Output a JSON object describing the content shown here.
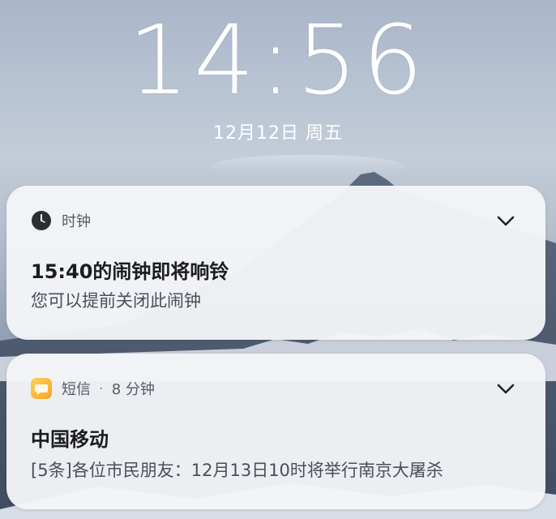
{
  "lockscreen": {
    "time": "14:56",
    "date": "12月12日 周五"
  },
  "notifications": [
    {
      "app_name": "时钟",
      "app_icon": "clock-icon",
      "title": "15:40的闹钟即将响铃",
      "body": "您可以提前关闭此闹钟"
    },
    {
      "app_name": "短信",
      "app_icon": "sms-icon",
      "separator": "·",
      "time_ago": "8 分钟",
      "title": "中国移动",
      "body": "[5条]各位市民朋友：12月13日10时将举行南京大屠杀"
    }
  ],
  "colors": {
    "card_background": "#f4f5f8",
    "sms_icon": "#f5a623",
    "text_primary": "#1b1c1f",
    "text_secondary": "#4a4f58"
  }
}
